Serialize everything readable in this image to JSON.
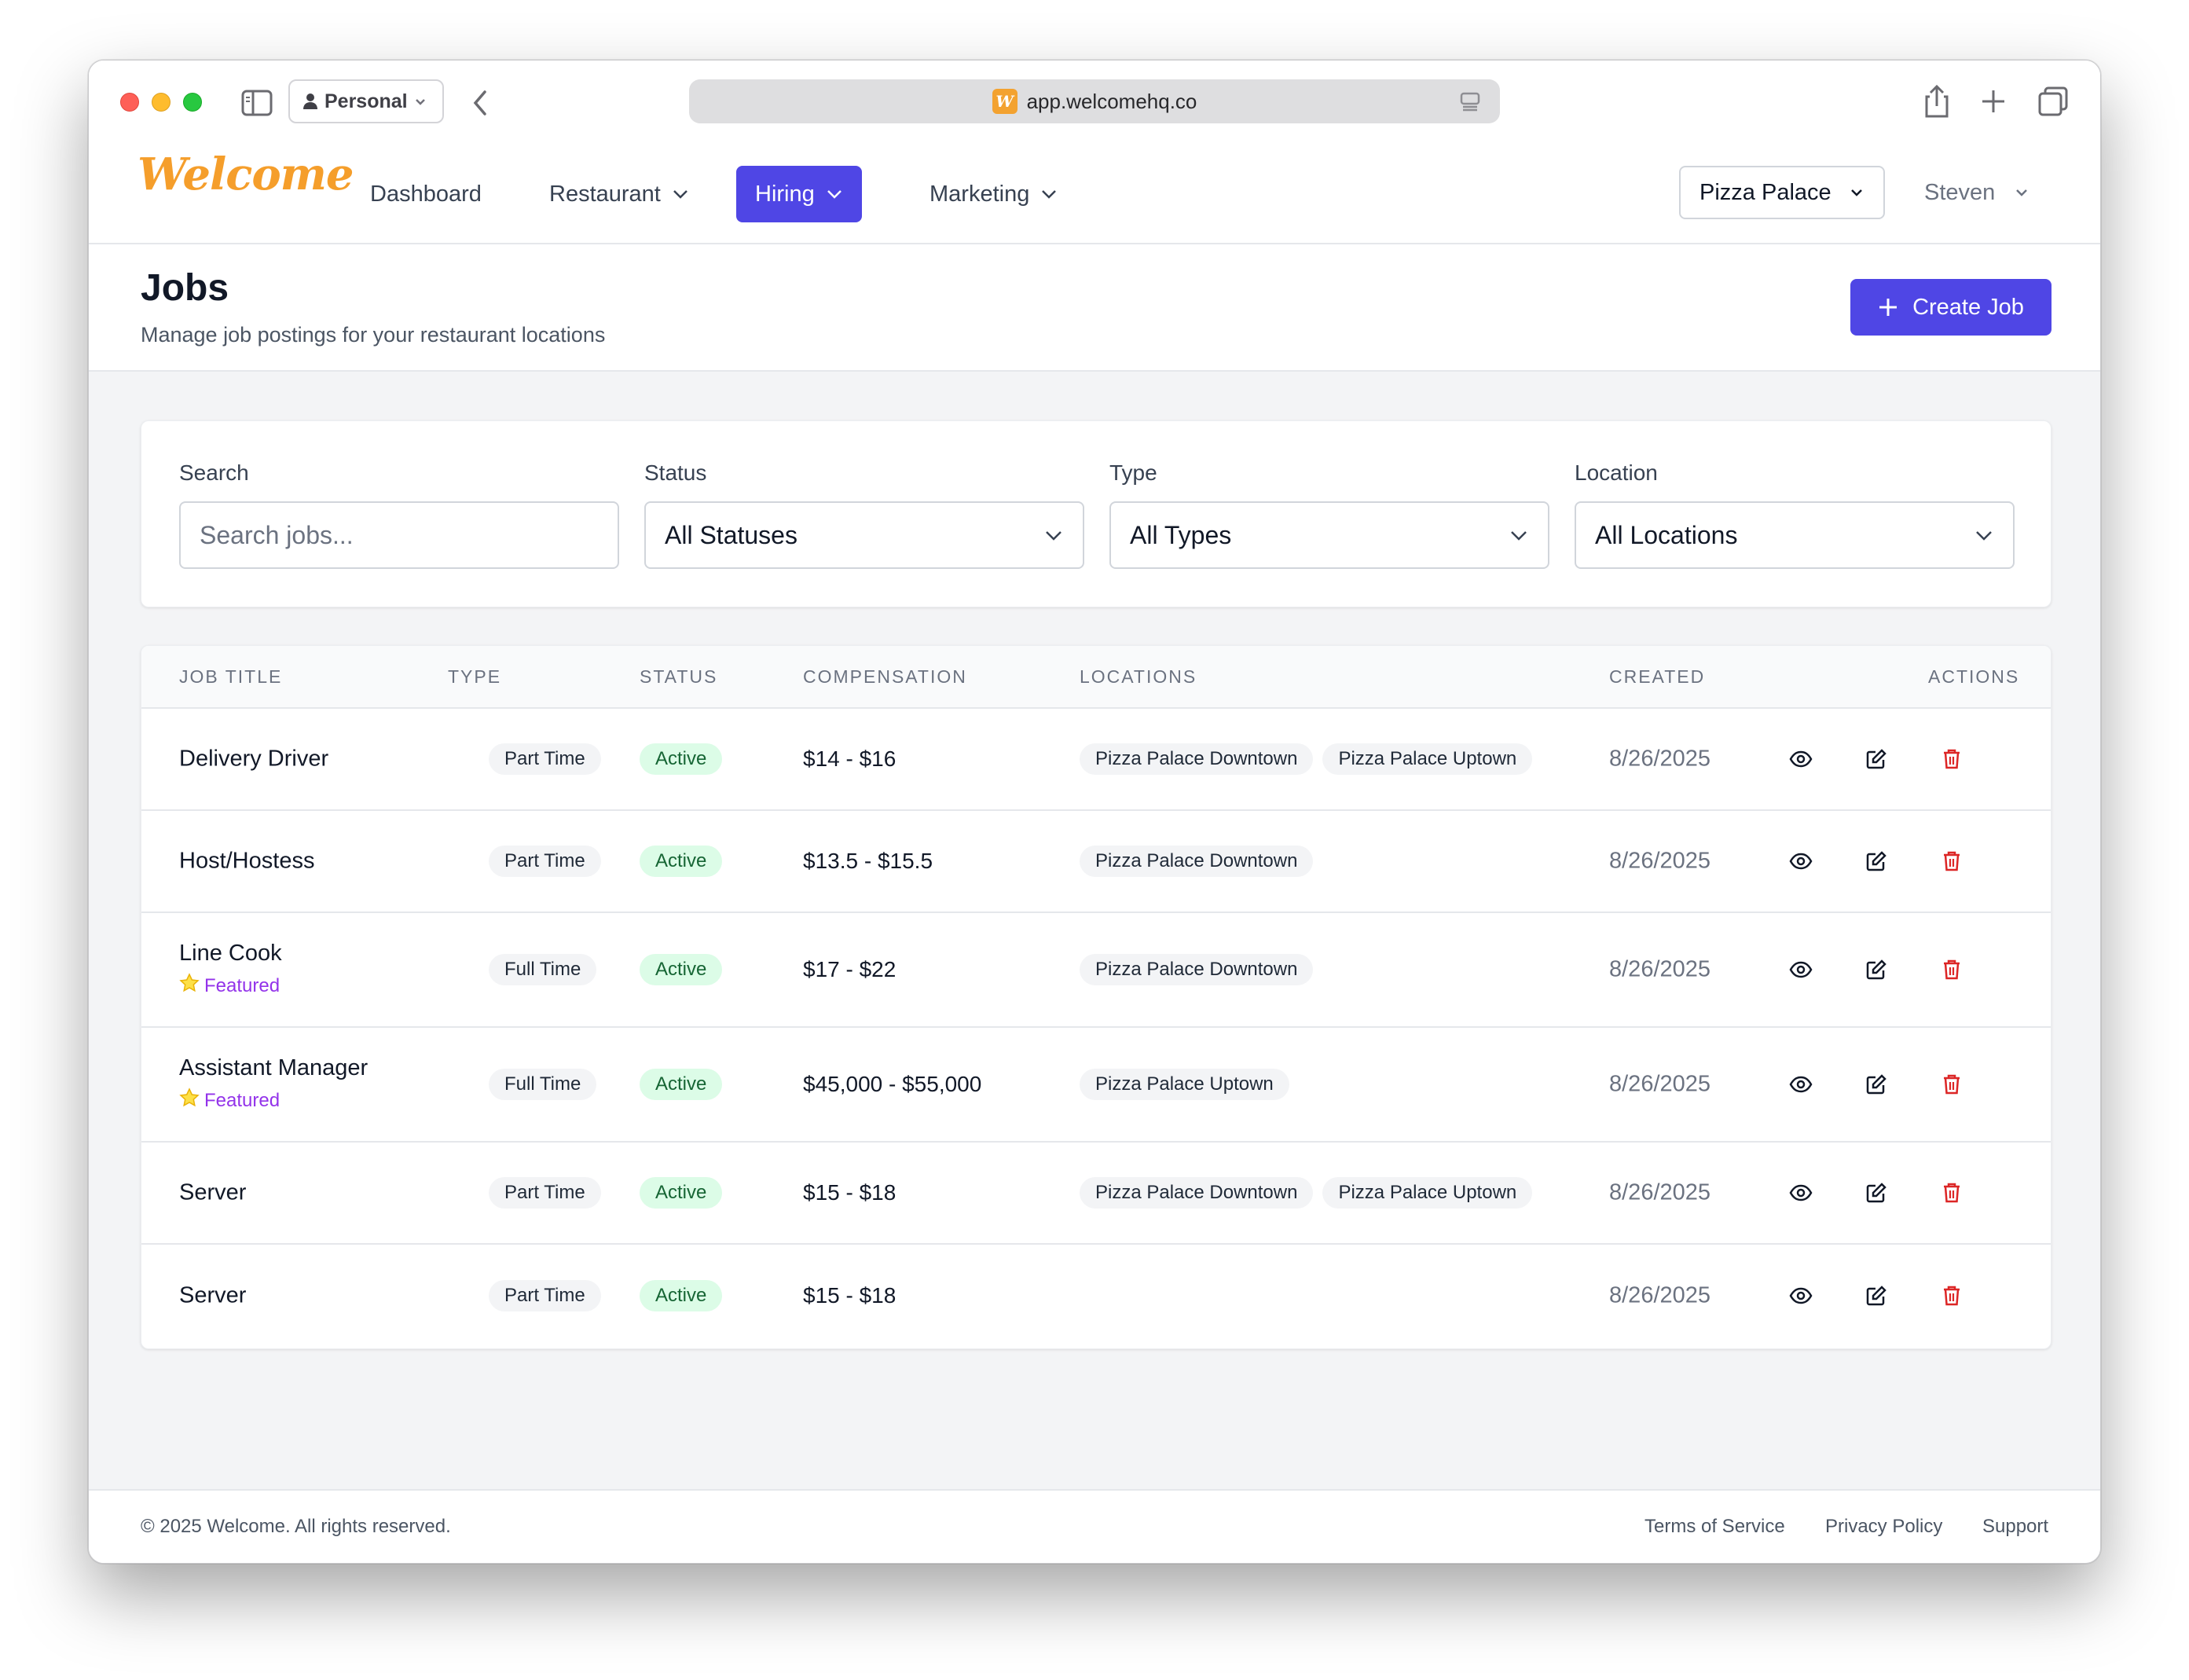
{
  "browser": {
    "profile_label": "Personal",
    "url": "app.welcomehq.co",
    "favicon_letter": "W"
  },
  "nav": {
    "logo": "Welcome",
    "items": [
      {
        "label": "Dashboard"
      },
      {
        "label": "Restaurant"
      },
      {
        "label": "Hiring"
      },
      {
        "label": "Marketing"
      }
    ],
    "restaurant_selector": "Pizza Palace",
    "user": "Steven"
  },
  "page": {
    "title": "Jobs",
    "subtitle": "Manage job postings for your restaurant locations",
    "create_button": "Create Job"
  },
  "filters": {
    "search_label": "Search",
    "search_placeholder": "Search jobs...",
    "status_label": "Status",
    "status_value": "All Statuses",
    "type_label": "Type",
    "type_value": "All Types",
    "location_label": "Location",
    "location_value": "All Locations"
  },
  "table": {
    "headers": [
      "JOB TITLE",
      "TYPE",
      "STATUS",
      "COMPENSATION",
      "LOCATIONS",
      "CREATED",
      "ACTIONS"
    ],
    "featured_label": "Featured",
    "rows": [
      {
        "title": "Delivery Driver",
        "featured": false,
        "type": "Part Time",
        "status": "Active",
        "compensation": "$14 - $16",
        "locations": [
          "Pizza Palace Downtown",
          "Pizza Palace Uptown"
        ],
        "created": "8/26/2025"
      },
      {
        "title": "Host/Hostess",
        "featured": false,
        "type": "Part Time",
        "status": "Active",
        "compensation": "$13.5 - $15.5",
        "locations": [
          "Pizza Palace Downtown"
        ],
        "created": "8/26/2025"
      },
      {
        "title": "Line Cook",
        "featured": true,
        "type": "Full Time",
        "status": "Active",
        "compensation": "$17 - $22",
        "locations": [
          "Pizza Palace Downtown"
        ],
        "created": "8/26/2025"
      },
      {
        "title": "Assistant Manager",
        "featured": true,
        "type": "Full Time",
        "status": "Active",
        "compensation": "$45,000 - $55,000",
        "locations": [
          "Pizza Palace Uptown"
        ],
        "created": "8/26/2025"
      },
      {
        "title": "Server",
        "featured": false,
        "type": "Part Time",
        "status": "Active",
        "compensation": "$15 - $18",
        "locations": [
          "Pizza Palace Downtown",
          "Pizza Palace Uptown"
        ],
        "created": "8/26/2025"
      },
      {
        "title": "Server",
        "featured": false,
        "type": "Part Time",
        "status": "Active",
        "compensation": "$15 - $18",
        "locations": [],
        "created": "8/26/2025"
      }
    ]
  },
  "footer": {
    "copyright": "© 2025 Welcome. All rights reserved.",
    "links": [
      "Terms of Service",
      "Privacy Policy",
      "Support"
    ]
  },
  "colors": {
    "primary": "#4f46e5",
    "logo": "#f59e2b",
    "active_badge_bg": "#dcfce7",
    "active_badge_text": "#166534",
    "featured": "#9333ea",
    "delete": "#dc2626"
  }
}
